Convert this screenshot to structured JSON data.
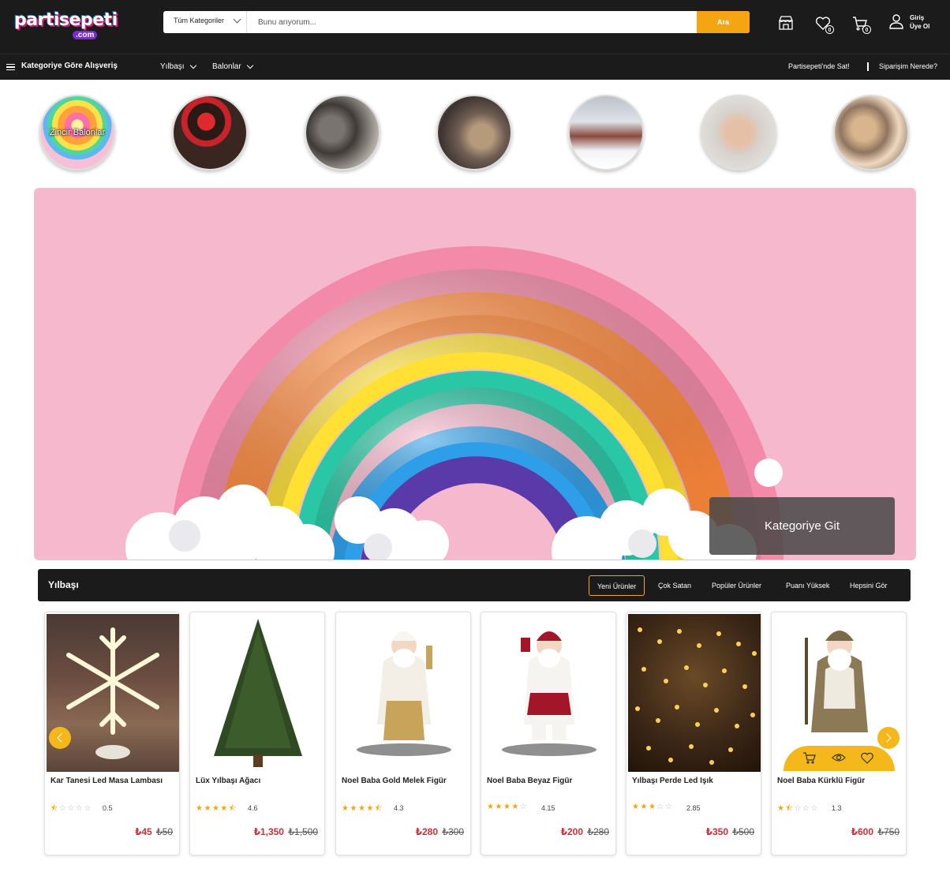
{
  "header": {
    "logo_text": "partisepeti",
    "logo_sub": ".com",
    "search": {
      "category": "Tüm Kategoriler",
      "placeholder": "Bunu arıyorum...",
      "button": "Ara"
    },
    "icons": {
      "store": "store-icon",
      "favorites": "heart-icon",
      "cart": "cart-icon",
      "account": "user-icon"
    },
    "favorites_count": "0",
    "cart_count": "0",
    "account": {
      "login": "Giriş",
      "register": "Üye Ol"
    }
  },
  "nav": {
    "category_menu": "Kategoriye Göre Alışveriş",
    "links": [
      "Yılbaşı",
      "Balonlar"
    ],
    "right": [
      "Partisepeti'nde Sat!",
      "Siparişim Nerede?"
    ]
  },
  "categories": [
    {
      "label": "Zincir Balonlar"
    }
  ],
  "hero": {
    "button": "Kategoriye Git",
    "colors": {
      "bg": "#f6b8cc"
    }
  },
  "section": {
    "title": "Yılbaşı",
    "tabs": [
      "Yeni Ürünler",
      "Çok Satan",
      "Popüler Ürünler",
      "Puanı Yüksek",
      "Hepsini Gör"
    ],
    "active_tab": "Yeni Ürünler"
  },
  "products": [
    {
      "name": "Kar Tanesi Led Masa Lambası",
      "rating": "0.5",
      "rating_value": 0.5,
      "price": "₺45",
      "old_price": "₺50"
    },
    {
      "name": "Lüx Yılbaşı Ağacı",
      "rating": "4.6",
      "rating_value": 4.6,
      "price": "₺1,350",
      "old_price": "₺1,500"
    },
    {
      "name": "Noel Baba Gold Melek Figür",
      "rating": "4.3",
      "rating_value": 4.3,
      "price": "₺280",
      "old_price": "₺300"
    },
    {
      "name": "Noel Baba Beyaz Figür",
      "rating": "4.15",
      "rating_value": 4.15,
      "price": "₺200",
      "old_price": "₺280"
    },
    {
      "name": "Yılbaşı Perde Led Işık",
      "rating": "2.85",
      "rating_value": 2.85,
      "price": "₺350",
      "old_price": "₺500"
    },
    {
      "name": "Noel Baba Kürklü Figür",
      "rating": "1.3",
      "rating_value": 1.3,
      "price": "₺600",
      "old_price": "₺750"
    }
  ],
  "colors": {
    "header_bg": "#1b1b1b",
    "accent": "#f5a511",
    "price": "#c8303b",
    "star": "#f5a511"
  }
}
